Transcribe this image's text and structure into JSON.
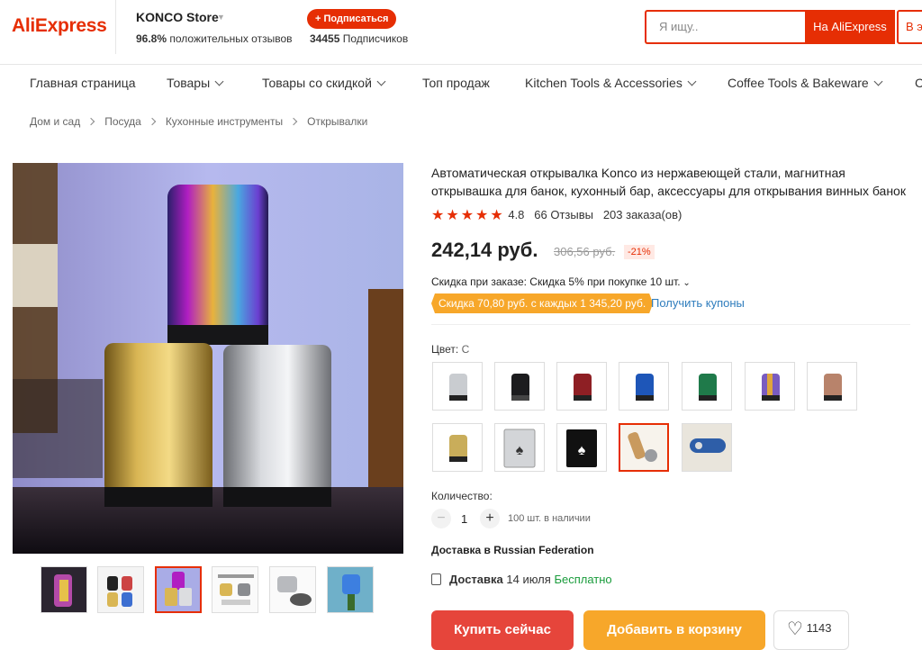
{
  "brand": {
    "logo_text": "AliExpress"
  },
  "store": {
    "name": "KONCO Store",
    "positive_pct": "96.8%",
    "positive_label": "положительных отзывов",
    "subscribe_label": "+ Подписаться",
    "followers_count": "34455",
    "followers_label": "Подписчиков"
  },
  "search": {
    "placeholder": "Я ищу..",
    "button_label": "На AliExpress",
    "secondary_button_label": "В э"
  },
  "nav": {
    "items": [
      {
        "label": "Главная страница",
        "dropdown": false
      },
      {
        "label": "Товары",
        "dropdown": true
      },
      {
        "label": "Товары со скидкой",
        "dropdown": true
      },
      {
        "label": "Топ продаж",
        "dropdown": false
      },
      {
        "label": "Kitchen Tools & Accessories",
        "dropdown": true
      },
      {
        "label": "Coffee Tools & Bakeware",
        "dropdown": true
      },
      {
        "label": "С",
        "dropdown": false
      }
    ]
  },
  "breadcrumbs": [
    "Дом и сад",
    "Посуда",
    "Кухонные инструменты",
    "Открывалки"
  ],
  "product": {
    "title": "Автоматическая открывалка Konco из нержавеющей стали, магнитная открывашка для банок, кухонный бар, аксессуары для открывания винных банок",
    "stars": "★★★★★",
    "rating": "4.8",
    "reviews": "66 Отзывы",
    "orders": "203 заказа(ов)",
    "price": "242,14 руб.",
    "old_price": "306,56 руб.",
    "discount": "-21%",
    "bulk_discount": "Скидка при заказе: Скидка 5% при покупке 10 шт.",
    "coupon": "Скидка 70,80 руб. с каждых 1 345,20 руб.",
    "get_coupons": "Получить купоны",
    "color_label": "Цвет:",
    "color_value": "C",
    "quantity_label": "Количество:",
    "quantity": "1",
    "minus": "−",
    "plus": "+",
    "stock": "100 шт. в наличии",
    "ship_to": "Доставка в Russian Federation",
    "delivery_label": "Доставка",
    "delivery_date": "14 июля",
    "delivery_price": "Бесплатно",
    "buy_now": "Купить сейчас",
    "add_to_cart": "Добавить в корзину",
    "wishlist_count": "1143"
  },
  "colors": {
    "swatches": [
      "#c9ccd0",
      "#1c1c1e",
      "#8e1f24",
      "#1e56b8",
      "#1f7a4a",
      "#7a5cc0",
      "#b8836b",
      "#c9ad5a"
    ]
  }
}
